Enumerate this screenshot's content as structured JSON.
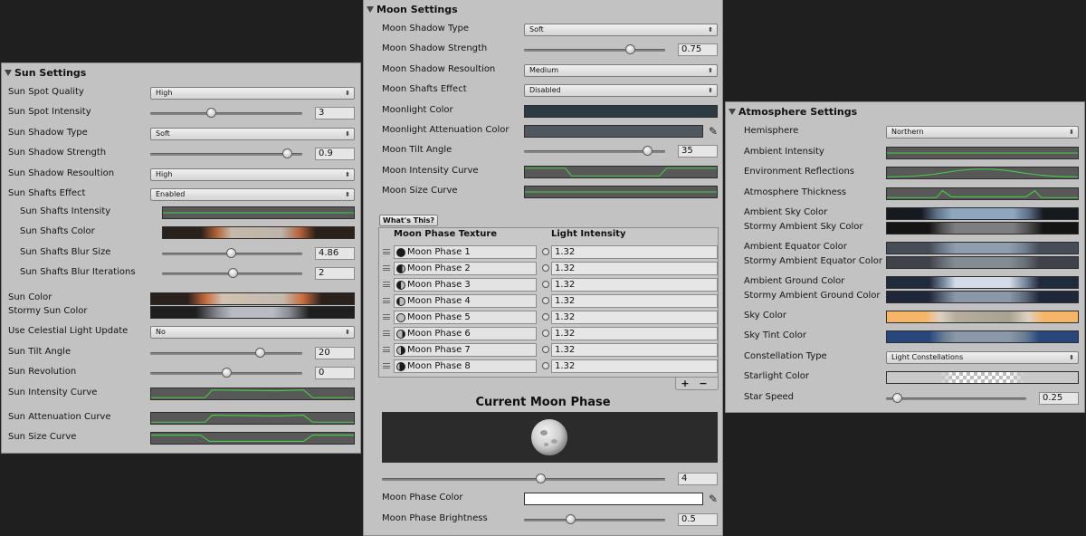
{
  "sun": {
    "title": "Sun Settings",
    "spot_quality": {
      "label": "Sun Spot Quality",
      "value": "High"
    },
    "spot_intensity": {
      "label": "Sun Spot Intensity",
      "value": "3",
      "level": 0.4
    },
    "shadow_type": {
      "label": "Sun Shadow Type",
      "value": "Soft"
    },
    "shadow_strength": {
      "label": "Sun Shadow Strength",
      "value": "0.9",
      "level": 0.9
    },
    "shadow_resolution": {
      "label": "Sun Shadow Resoultion",
      "value": "High"
    },
    "shafts_effect": {
      "label": "Sun Shafts Effect",
      "value": "Enabled"
    },
    "shafts_intensity": {
      "label": "Sun Shafts Intensity"
    },
    "shafts_color": {
      "label": "Sun Shafts Color"
    },
    "shafts_blur_size": {
      "label": "Sun Shafts Blur Size",
      "value": "4.86",
      "level": 0.49
    },
    "shafts_blur_iterations": {
      "label": "Sun Shafts Blur Iterations",
      "value": "2",
      "level": 0.5
    },
    "color": {
      "label": "Sun Color"
    },
    "stormy_color": {
      "label": "Stormy Sun Color"
    },
    "celestial_update": {
      "label": "Use Celestial Light Update",
      "value": "No"
    },
    "tilt_angle": {
      "label": "Sun Tilt Angle",
      "value": "20",
      "level": 0.72
    },
    "revolution": {
      "label": "Sun Revolution",
      "value": "0",
      "level": 0.5
    },
    "intensity_curve": {
      "label": "Sun Intensity Curve"
    },
    "attenuation_curve": {
      "label": "Sun Attenuation Curve"
    },
    "size_curve": {
      "label": "Sun Size Curve"
    }
  },
  "moon": {
    "title": "Moon Settings",
    "shadow_type": {
      "label": "Moon Shadow Type",
      "value": "Soft"
    },
    "shadow_strength": {
      "label": "Moon Shadow Strength",
      "value": "0.75",
      "level": 0.75
    },
    "shadow_resolution": {
      "label": "Moon Shadow Resoultion",
      "value": "Medium"
    },
    "shafts_effect": {
      "label": "Moon Shafts Effect",
      "value": "Disabled"
    },
    "light_color": {
      "label": "Moonlight Color",
      "color": "#2c3a44"
    },
    "attenuation_color": {
      "label": "Moonlight Attenuation Color",
      "color": "#4f5861"
    },
    "tilt_angle": {
      "label": "Moon Tilt Angle",
      "value": "35",
      "level": 0.87
    },
    "intensity_curve": {
      "label": "Moon Intensity Curve"
    },
    "size_curve": {
      "label": "Moon Size Curve"
    },
    "whats_this": "What's This?",
    "table": {
      "col1": "Moon Phase Texture",
      "col2": "Light Intensity",
      "rows": [
        {
          "name": "Moon Phase 1",
          "value": "1.32"
        },
        {
          "name": "Moon Phase 2",
          "value": "1.32"
        },
        {
          "name": "Moon Phase 3",
          "value": "1.32"
        },
        {
          "name": "Moon Phase 4",
          "value": "1.32"
        },
        {
          "name": "Moon Phase 5",
          "value": "1.32"
        },
        {
          "name": "Moon Phase 6",
          "value": "1.32"
        },
        {
          "name": "Moon Phase 7",
          "value": "1.32"
        },
        {
          "name": "Moon Phase 8",
          "value": "1.32"
        }
      ],
      "add": "+",
      "remove": "−"
    },
    "current_phase_title": "Current Moon Phase",
    "phase_index": {
      "value": "4",
      "level": 0.56
    },
    "phase_color": {
      "label": "Moon Phase Color",
      "color": "#ffffff"
    },
    "phase_brightness": {
      "label": "Moon Phase Brightness",
      "value": "0.5",
      "level": 0.33
    }
  },
  "atmosphere": {
    "title": "Atmosphere Settings",
    "hemisphere": {
      "label": "Hemisphere",
      "value": "Northern"
    },
    "ambient_intensity": {
      "label": "Ambient Intensity"
    },
    "env_reflections": {
      "label": "Environment Reflections"
    },
    "thickness": {
      "label": "Atmosphere Thickness"
    },
    "ambient_sky": {
      "label": "Ambient Sky Color"
    },
    "stormy_ambient_sky": {
      "label": "Stormy Ambient Sky Color"
    },
    "ambient_equator": {
      "label": "Ambient Equator Color"
    },
    "stormy_ambient_equator": {
      "label": "Stormy Ambient Equator Color"
    },
    "ambient_ground": {
      "label": "Ambient Ground Color"
    },
    "stormy_ambient_ground": {
      "label": "Stormy Ambient Ground Color"
    },
    "sky_color": {
      "label": "Sky Color"
    },
    "sky_tint": {
      "label": "Sky Tint Color"
    },
    "constellation": {
      "label": "Constellation Type",
      "value": "Light Constellations"
    },
    "starlight": {
      "label": "Starlight Color"
    },
    "star_speed": {
      "label": "Star Speed",
      "value": "0.25",
      "level": 0.08
    }
  }
}
